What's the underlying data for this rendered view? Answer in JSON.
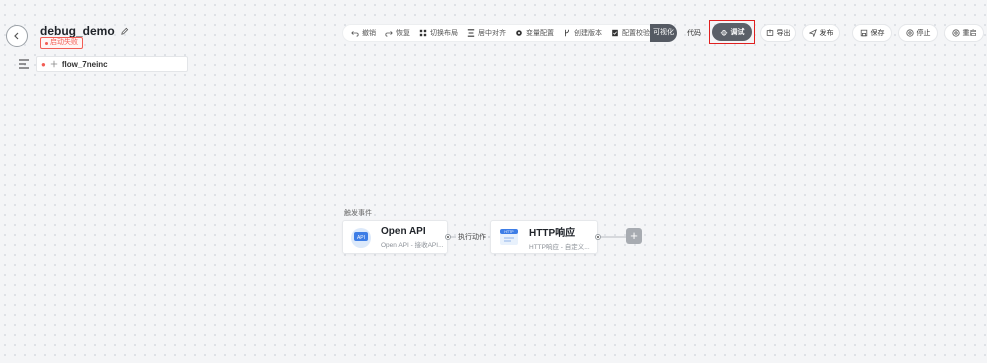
{
  "header": {
    "title": "debug_demo",
    "status": "启动失败"
  },
  "flow_tab": {
    "label": "flow_7neinc"
  },
  "toolbar": {
    "items": [
      "撤销",
      "恢复",
      "切换布局",
      "居中对齐",
      "变量配置",
      "创建版本",
      "配置校验"
    ],
    "view_visual": "可视化",
    "view_code": "代码",
    "debug": "调试",
    "export": "导出",
    "publish": "发布",
    "save": "保存",
    "stop": "停止",
    "restart": "重启"
  },
  "canvas": {
    "trigger_label": "触发事件",
    "edge_label": "执行动作",
    "nodes": [
      {
        "title": "Open API",
        "subtitle": "Open API - 接收API...",
        "icon": "api-icon",
        "icon_text": "API"
      },
      {
        "title": "HTTP响应",
        "subtitle": "HTTP响应 - 自定义...",
        "icon": "http-icon",
        "icon_text": "HTTP"
      }
    ]
  },
  "colors": {
    "error": "#f25c54",
    "debug_outline": "#e02020",
    "dark_button": "#5b6068"
  }
}
